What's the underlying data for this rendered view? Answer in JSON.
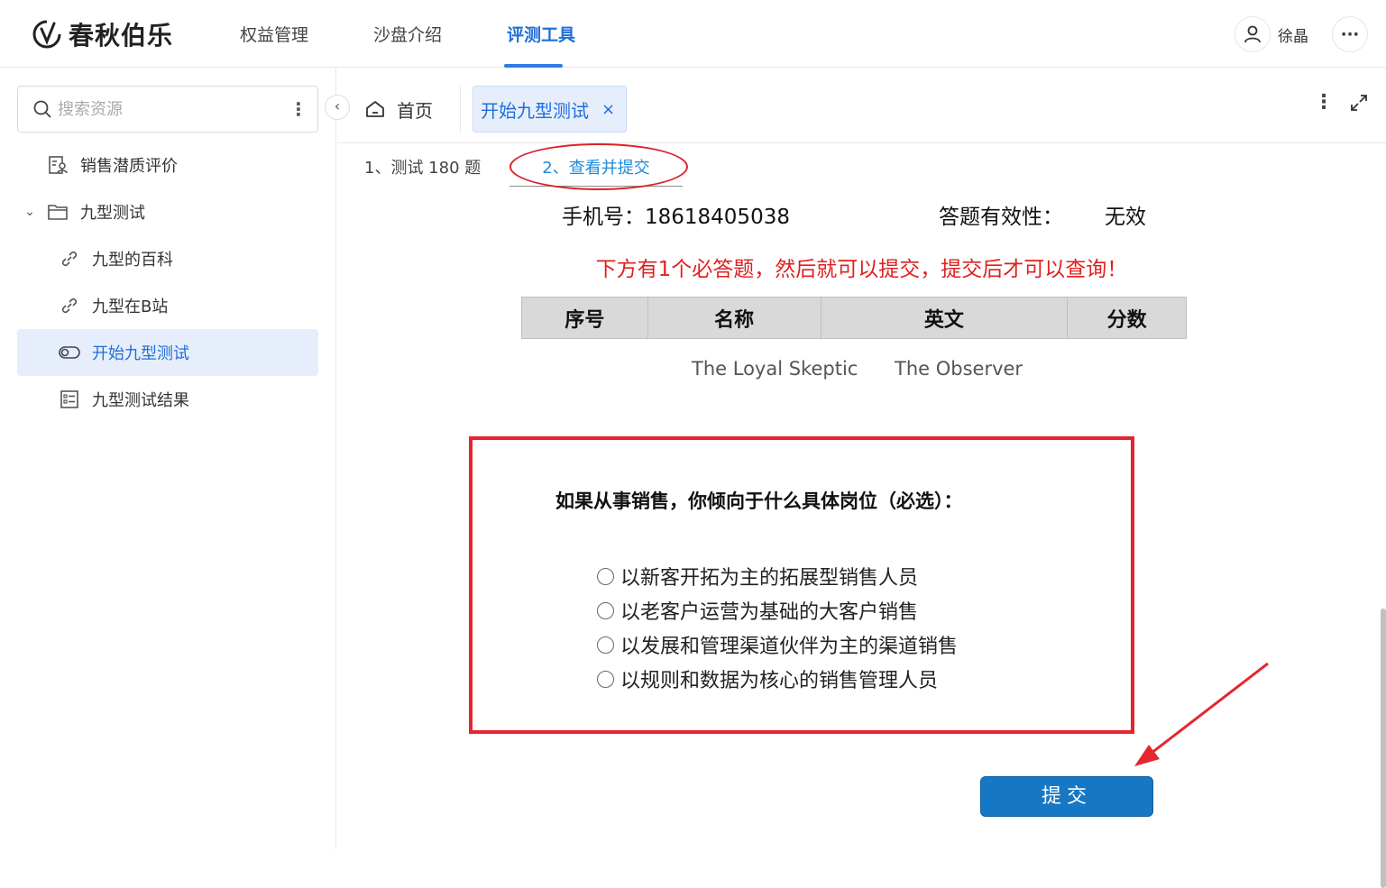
{
  "header": {
    "logo_text": "春秋伯乐",
    "nav": [
      {
        "label": "权益管理",
        "active": false
      },
      {
        "label": "沙盘介绍",
        "active": false
      },
      {
        "label": "评测工具",
        "active": true
      }
    ],
    "user_name": "徐晶",
    "more_label": "···"
  },
  "sidebar": {
    "search_placeholder": "搜索资源",
    "search_more": "⋮",
    "collapse": "‹",
    "items": [
      {
        "label": "销售潜质评价",
        "icon": "report-user-icon"
      },
      {
        "label": "九型测试",
        "icon": "folder-icon",
        "expanded": true
      },
      {
        "label": "九型的百科",
        "icon": "link-icon"
      },
      {
        "label": "九型在B站",
        "icon": "link-icon"
      },
      {
        "label": "开始九型测试",
        "icon": "toggle-icon",
        "active": true
      },
      {
        "label": "九型测试结果",
        "icon": "checklist-icon"
      }
    ]
  },
  "tabs": {
    "home_label": "首页",
    "active_label": "开始九型测试",
    "close": "×",
    "more": "⋮"
  },
  "steps": [
    {
      "label": "1、测试 180 题",
      "active": false
    },
    {
      "label": "2、查看并提交",
      "active": true
    }
  ],
  "info": {
    "phone_label": "手机号：",
    "phone_value": "18618405038",
    "validity_label": "答题有效性：",
    "validity_value": "无效"
  },
  "notice": "下方有1个必答题，然后就可以提交，提交后才可以查询！",
  "table": {
    "headers": [
      "序号",
      "名称",
      "英文",
      "分数"
    ]
  },
  "types": [
    "The Loyal Skeptic",
    "The Observer"
  ],
  "question": {
    "title": "如果从事销售，你倾向于什么具体岗位（必选）：",
    "options": [
      "以新客开拓为主的拓展型销售人员",
      "以老客户运营为基础的大客户销售",
      "以发展和管理渠道伙伴为主的渠道销售",
      "以规则和数据为核心的销售管理人员"
    ]
  },
  "submit_label": "提交",
  "colors": {
    "accent": "#1f6fd9",
    "highlight_red": "#e5262e",
    "submit_blue": "#1677c5"
  }
}
